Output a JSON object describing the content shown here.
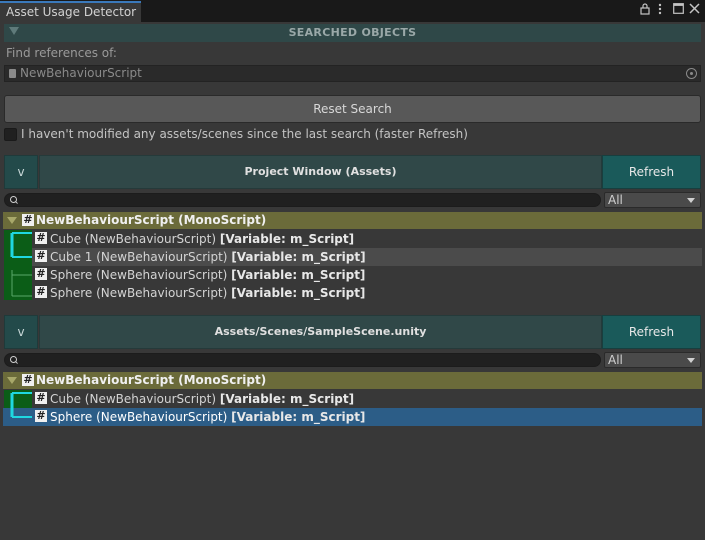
{
  "window": {
    "tab_title": "Asset Usage Detector",
    "icons": [
      "lock-icon",
      "more-vertical-icon",
      "maximize-icon",
      "close-icon"
    ]
  },
  "searched_objects": {
    "section_label": "SEARCHED OBJECTS",
    "find_label": "Find references of:",
    "object_value": "NewBehaviourScript"
  },
  "actions": {
    "reset_label": "Reset Search",
    "checkbox_label": "I haven't modified any assets/scenes since the last search (faster Refresh)",
    "checkbox_checked": false
  },
  "groups": [
    {
      "toggle_label": "v",
      "title": "Project Window (Assets)",
      "refresh_label": "Refresh",
      "search_value": "",
      "filter_value": "All",
      "script_name": "NewBehaviourScript (MonoScript)",
      "rows": [
        {
          "name": "Cube (NewBehaviourScript)",
          "detail": "[Variable: m_Script]"
        },
        {
          "name": "Cube 1 (NewBehaviourScript)",
          "detail": "[Variable: m_Script]"
        },
        {
          "name": "Sphere (NewBehaviourScript)",
          "detail": "[Variable: m_Script]"
        },
        {
          "name": "Sphere (NewBehaviourScript)",
          "detail": "[Variable: m_Script]"
        }
      ]
    },
    {
      "toggle_label": "v",
      "title": "Assets/Scenes/SampleScene.unity",
      "refresh_label": "Refresh",
      "search_value": "",
      "filter_value": "All",
      "script_name": "NewBehaviourScript (MonoScript)",
      "rows": [
        {
          "name": "Cube (NewBehaviourScript)",
          "detail": "[Variable: m_Script]"
        },
        {
          "name": "Sphere (NewBehaviourScript)",
          "detail": "[Variable: m_Script]"
        }
      ]
    }
  ],
  "colors": {
    "accent_cyan": "#1fd7e0",
    "group_green": "#0b5d17",
    "script_header": "#6b6b3a",
    "selection": "#2c5d87",
    "refresh_teal": "#1a5a5a"
  }
}
